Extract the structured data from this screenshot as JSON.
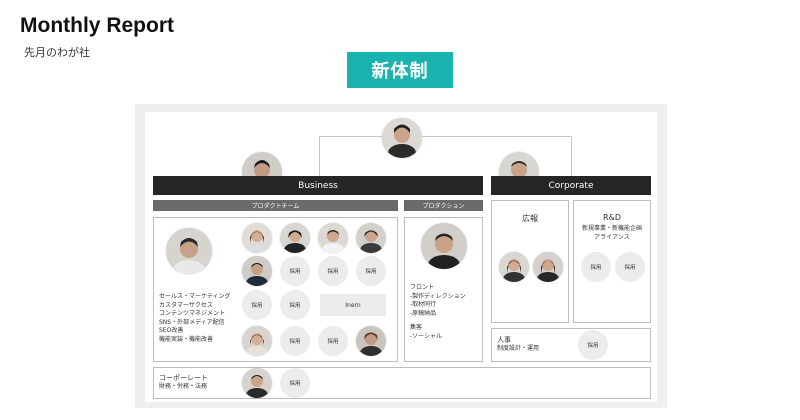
{
  "header": {
    "title": "Monthly Report",
    "subtitle": "先月のわが社"
  },
  "badge": {
    "label": "新体制"
  },
  "business": {
    "label": "Business"
  },
  "corporate": {
    "label": "Corporate"
  },
  "product_team": {
    "label": "プロダクトチーム",
    "duties": [
      "セールス・マーケティング",
      "カスタマーサクセス",
      "コンテンツマネジメント",
      "SNS・外部メディア配信",
      "SEO改善",
      "機能実装・機能改善"
    ],
    "hiring_label": "採用",
    "intern_label": "Inern"
  },
  "production": {
    "label": "プロダクション",
    "front_title": "フロント",
    "front_items": [
      "-製作ディレクション",
      "-取材同行",
      "-原稿納品"
    ],
    "acquisition_title": "集客",
    "acquisition_items": [
      "-ソーシャル"
    ]
  },
  "pr": {
    "label": "広報"
  },
  "rnd": {
    "label": "R&D",
    "desc_lines": [
      "新規事業・新機能企画",
      "アライアンス"
    ],
    "hiring_label": "採用"
  },
  "hr": {
    "label": "人事",
    "desc": "制度設計・運用",
    "hiring_label": "採用"
  },
  "corporate_row": {
    "label": "コーポーレート",
    "desc": "財務・労務・法務",
    "hiring_label": "採用"
  },
  "colors": {
    "accent": "#1bb3ad",
    "dark_bar": "#262626",
    "gray_bar": "#6a6a6a"
  }
}
